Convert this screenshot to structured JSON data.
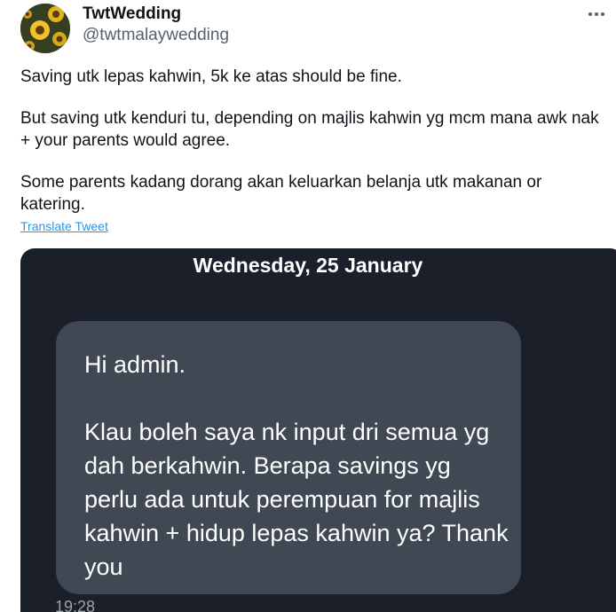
{
  "author": {
    "display_name": "TwtWedding",
    "handle": "@twtmalaywedding"
  },
  "tweet": {
    "paragraphs": [
      "Saving utk lepas kahwin, 5k ke atas should be fine.",
      "But saving utk kenduri tu, depending on majlis kahwin yg mcm mana awk nak + your parents would agree.",
      "Some parents kadang dorang akan keluarkan belanja utk makanan or katering."
    ],
    "translate_label": "Translate Tweet"
  },
  "media": {
    "date_header": "Wednesday, 25 January",
    "message_text": "Hi admin.\n\nKlau boleh saya nk input dri semua yg dah berkahwin. Berapa savings yg perlu ada untuk perempuan for majlis kahwin + hidup lepas kahwin ya? Thank you",
    "message_time": "19:28"
  },
  "icons": {
    "avatar": "sunflower-avatar",
    "more": "more-options-icon"
  }
}
